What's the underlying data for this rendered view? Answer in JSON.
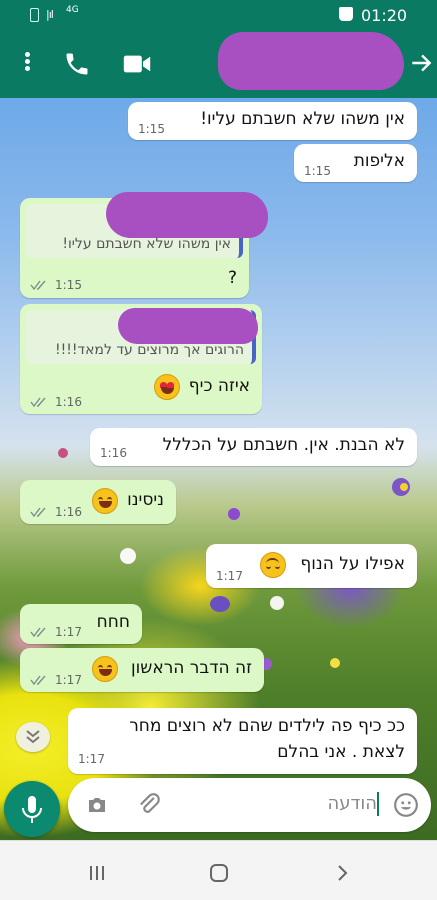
{
  "status_bar": {
    "time": "01:20",
    "network": "4G",
    "signal": "|ıl",
    "icons": [
      "battery-icon",
      "signal-icon",
      "network-4g-icon",
      "shopping-bag-icon"
    ]
  },
  "header": {
    "icons": [
      "more-vert-icon",
      "call-icon",
      "video-call-icon",
      "back-arrow-icon"
    ],
    "accent": "#0b7a63"
  },
  "messages": [
    {
      "dir": "in",
      "text": "אין משהו שלא חשבתם עליו!",
      "time": "1:15"
    },
    {
      "dir": "in",
      "text": "אליפות",
      "time": "1:15"
    },
    {
      "dir": "out",
      "quote": "אין משהו שלא חשבתם עליו!",
      "text": "?",
      "time": "1:15",
      "status": "read"
    },
    {
      "dir": "out",
      "quote": "הרוגים אך מרוצים עד למאד!!!!",
      "text": "איזה כיף",
      "emoji": "heart-eyes-emoji",
      "time": "1:16",
      "status": "read"
    },
    {
      "dir": "in",
      "text": "לא הבנת. אין. חשבתם על הכללל",
      "time": "1:16"
    },
    {
      "dir": "out",
      "text": "ניסינו",
      "emoji": "smiling-emoji",
      "time": "1:16",
      "status": "read"
    },
    {
      "dir": "in",
      "text": "אפילו על הנוף",
      "emoji": "upside-down-emoji",
      "time": "1:17"
    },
    {
      "dir": "out",
      "text": "חחח",
      "time": "1:17",
      "status": "read"
    },
    {
      "dir": "out",
      "text": "זה הדבר הראשון",
      "emoji": "grinning-emoji",
      "time": "1:17",
      "status": "read"
    },
    {
      "dir": "in",
      "text_line1": "ככ כיף פה לילדים שהם לא רוצים מחר",
      "text_line2": "לצאת . אני בהלם",
      "time": "1:17"
    }
  ],
  "composer": {
    "placeholder": "הודעה",
    "icons": [
      "emoji-icon",
      "attach-icon",
      "camera-icon",
      "mic-icon"
    ]
  },
  "colors": {
    "incoming": "#ffffff",
    "outgoing": "#dcf8c6",
    "brand": "#0b7a63"
  }
}
